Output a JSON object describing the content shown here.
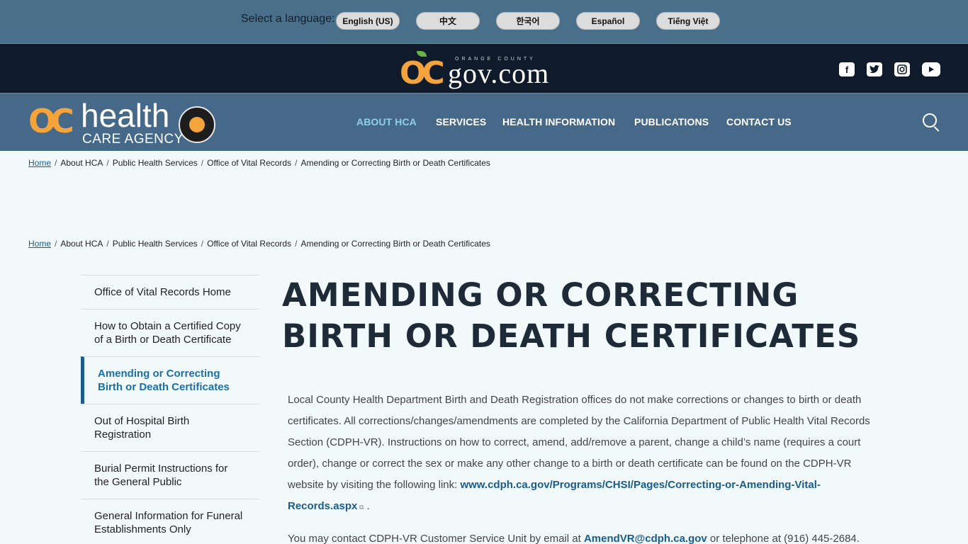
{
  "language_bar": {
    "label": "Select a language:",
    "options": [
      "English (US)",
      "中文",
      "한국어",
      "Español",
      "Tiếng Việt"
    ]
  },
  "ocgov": {
    "logo_text": "gov.com",
    "logo_mark": "OC",
    "logo_small": "ORANGE COUNTY"
  },
  "hca": {
    "logo_mark": "OC",
    "logo_health": "health",
    "logo_agency": "CARE AGENCY"
  },
  "nav": [
    "ABOUT HCA",
    "SERVICES",
    "HEALTH INFORMATION",
    "PUBLICATIONS",
    "CONTACT US"
  ],
  "breadcrumb": {
    "home": "Home",
    "items": [
      "About HCA",
      "Public Health Services",
      "Office of Vital Records",
      "Amending or Correcting Birth or Death Certificates"
    ]
  },
  "sidebar": [
    "Office of Vital Records Home",
    "How to Obtain a Certified Copy of a Birth or Death Certificate",
    "Amending or Correcting Birth or Death Certificates",
    "Out of Hospital Birth Registration",
    "Burial Permit Instructions for the General Public",
    "General Information for Funeral Establishments Only"
  ],
  "page": {
    "title": "AMENDING OR CORRECTING BIRTH OR DEATH CERTIFICATES",
    "para1": "Local County Health Department Birth and Death Registration offices do not make corrections or changes to birth or death certificates. All corrections/changes/amendments are completed by the California Department of Public Health Vital Records Section (CDPH-VR). Instructions on how to correct, amend, add/remove a parent, change a child’s name (requires a court order), change or correct the sex or make any other change to a birth or death certificate can be found on the CDPH-VR website by visiting the following link: ",
    "link1": "www.cdph.ca.gov/Programs/CHSI/Pages/Correcting-or-Amending-Vital-Records.aspx",
    "para1_end": " .",
    "para2_start": "You may contact CDPH-VR Customer Service Unit by email at ",
    "email": "AmendVR@cdph.ca.gov",
    "para2_end": " or telephone at (916) 445-2684."
  }
}
